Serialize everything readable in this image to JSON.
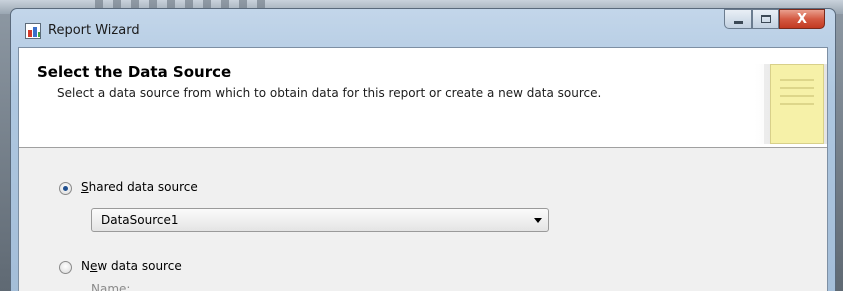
{
  "window": {
    "title": "Report Wizard",
    "icon": "report-wizard-icon",
    "controls": {
      "minimize": "minimize-icon",
      "maximize": "maximize-icon",
      "close_glyph": "X"
    }
  },
  "header": {
    "title": "Select the Data Source",
    "description": "Select a data source from which to obtain data for this report or create a new data source.",
    "image": "notepad-icon"
  },
  "shared_source": {
    "label_mnemonic": "S",
    "label_rest": "hared data source",
    "selected": true,
    "dropdown_value": "DataSource1"
  },
  "new_source": {
    "label_first": "N",
    "label_mnemonic": "e",
    "label_rest": "w data source",
    "selected": false,
    "name_label_first": "N",
    "name_label_mnemonic": "a",
    "name_label_rest": "me:"
  },
  "colors": {
    "accent": "#1f4f8f",
    "close_button": "#c23a22"
  }
}
